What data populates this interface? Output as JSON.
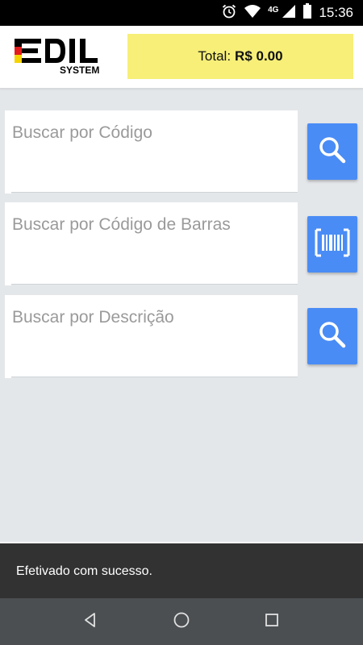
{
  "status_bar": {
    "time": "15:36",
    "network": "4G",
    "icons": [
      "alarm-icon",
      "wifi-icon",
      "signal-icon",
      "battery-icon"
    ]
  },
  "header": {
    "logo": {
      "text": "EDIL",
      "subtext": "SYSTEM",
      "colors": [
        "#000000",
        "#e31b1b",
        "#f5d300"
      ]
    },
    "total_label": "Total:",
    "total_value": "R$ 0.00",
    "total_bg": "#f7ef78"
  },
  "search": {
    "code": {
      "placeholder": "Buscar por Código",
      "value": "",
      "button_icon": "search-icon"
    },
    "barcode": {
      "placeholder": "Buscar por Código de Barras",
      "value": "",
      "button_icon": "barcode-scan-icon"
    },
    "description": {
      "placeholder": "Buscar por Descrição",
      "value": "",
      "button_icon": "search-icon"
    },
    "button_color": "#4a8cf5"
  },
  "snackbar": {
    "message": "Efetivado com sucesso."
  },
  "nav": {
    "buttons": [
      "back-icon",
      "home-icon",
      "recents-icon"
    ]
  }
}
